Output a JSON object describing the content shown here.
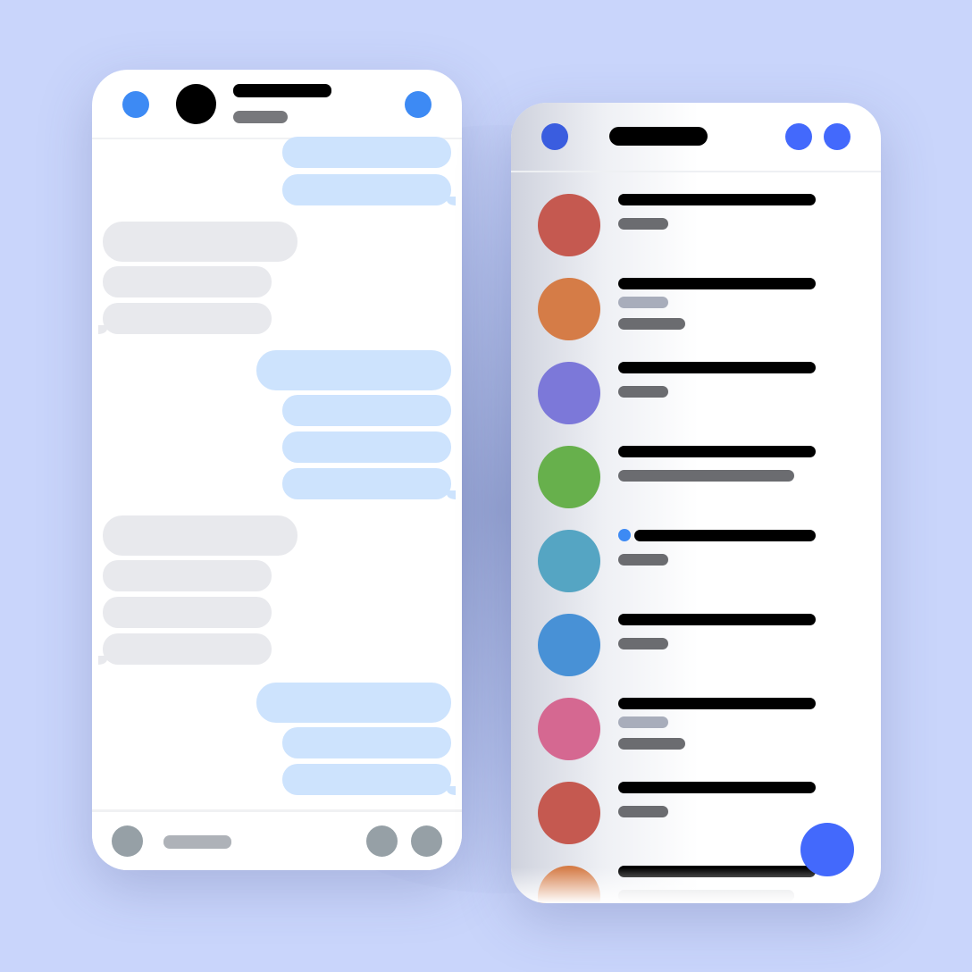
{
  "colors": {
    "background": "#c9d5fb",
    "outgoing_bubble": "#cde3fd",
    "incoming_bubble": "#e8e9ed",
    "header_icon_blue": "#3d8af4",
    "list_accent": "#4369fc",
    "list_back_icon": "#3a5ddf",
    "footer_icon_gray": "#96a0a6",
    "title_bar_black": "#000000",
    "subtitle_gray": "#6b6c70",
    "unread_preview_gray": "#a8adbb",
    "unread_dot": "#3d8af4"
  },
  "chat_screen": {
    "header": {
      "icons": [
        "back-icon",
        "avatar",
        "info-icon"
      ]
    },
    "messages": [
      {
        "direction": "outgoing",
        "group": 1
      },
      {
        "direction": "outgoing",
        "group": 1
      },
      {
        "direction": "incoming",
        "group": 2
      },
      {
        "direction": "incoming",
        "group": 2
      },
      {
        "direction": "incoming",
        "group": 2
      },
      {
        "direction": "outgoing",
        "group": 3
      },
      {
        "direction": "outgoing",
        "group": 3
      },
      {
        "direction": "outgoing",
        "group": 3
      },
      {
        "direction": "outgoing",
        "group": 3
      },
      {
        "direction": "incoming",
        "group": 4
      },
      {
        "direction": "incoming",
        "group": 4
      },
      {
        "direction": "incoming",
        "group": 4
      },
      {
        "direction": "incoming",
        "group": 4
      },
      {
        "direction": "outgoing",
        "group": 5
      },
      {
        "direction": "outgoing",
        "group": 5
      },
      {
        "direction": "outgoing",
        "group": 5
      }
    ],
    "footer": {
      "icons": [
        "add-icon",
        "camera-icon",
        "microphone-icon"
      ]
    }
  },
  "list_screen": {
    "header": {
      "icons": [
        "back-icon",
        "search-icon",
        "compose-icon"
      ]
    },
    "conversations": [
      {
        "avatar_color": "#c55950",
        "unread": false,
        "preview_lines": 1
      },
      {
        "avatar_color": "#d57c47",
        "unread": false,
        "preview_lines": 2
      },
      {
        "avatar_color": "#7c78d9",
        "unread": false,
        "preview_lines": 1
      },
      {
        "avatar_color": "#67b04c",
        "unread": false,
        "preview_lines": 1
      },
      {
        "avatar_color": "#55a5c3",
        "unread": true,
        "preview_lines": 1
      },
      {
        "avatar_color": "#4891d6",
        "unread": false,
        "preview_lines": 1
      },
      {
        "avatar_color": "#d56891",
        "unread": false,
        "preview_lines": 2
      },
      {
        "avatar_color": "#c55950",
        "unread": false,
        "preview_lines": 1
      },
      {
        "avatar_color": "#d57c47",
        "unread": false,
        "preview_lines": 1
      }
    ],
    "fab_icon": "new-message-icon"
  }
}
